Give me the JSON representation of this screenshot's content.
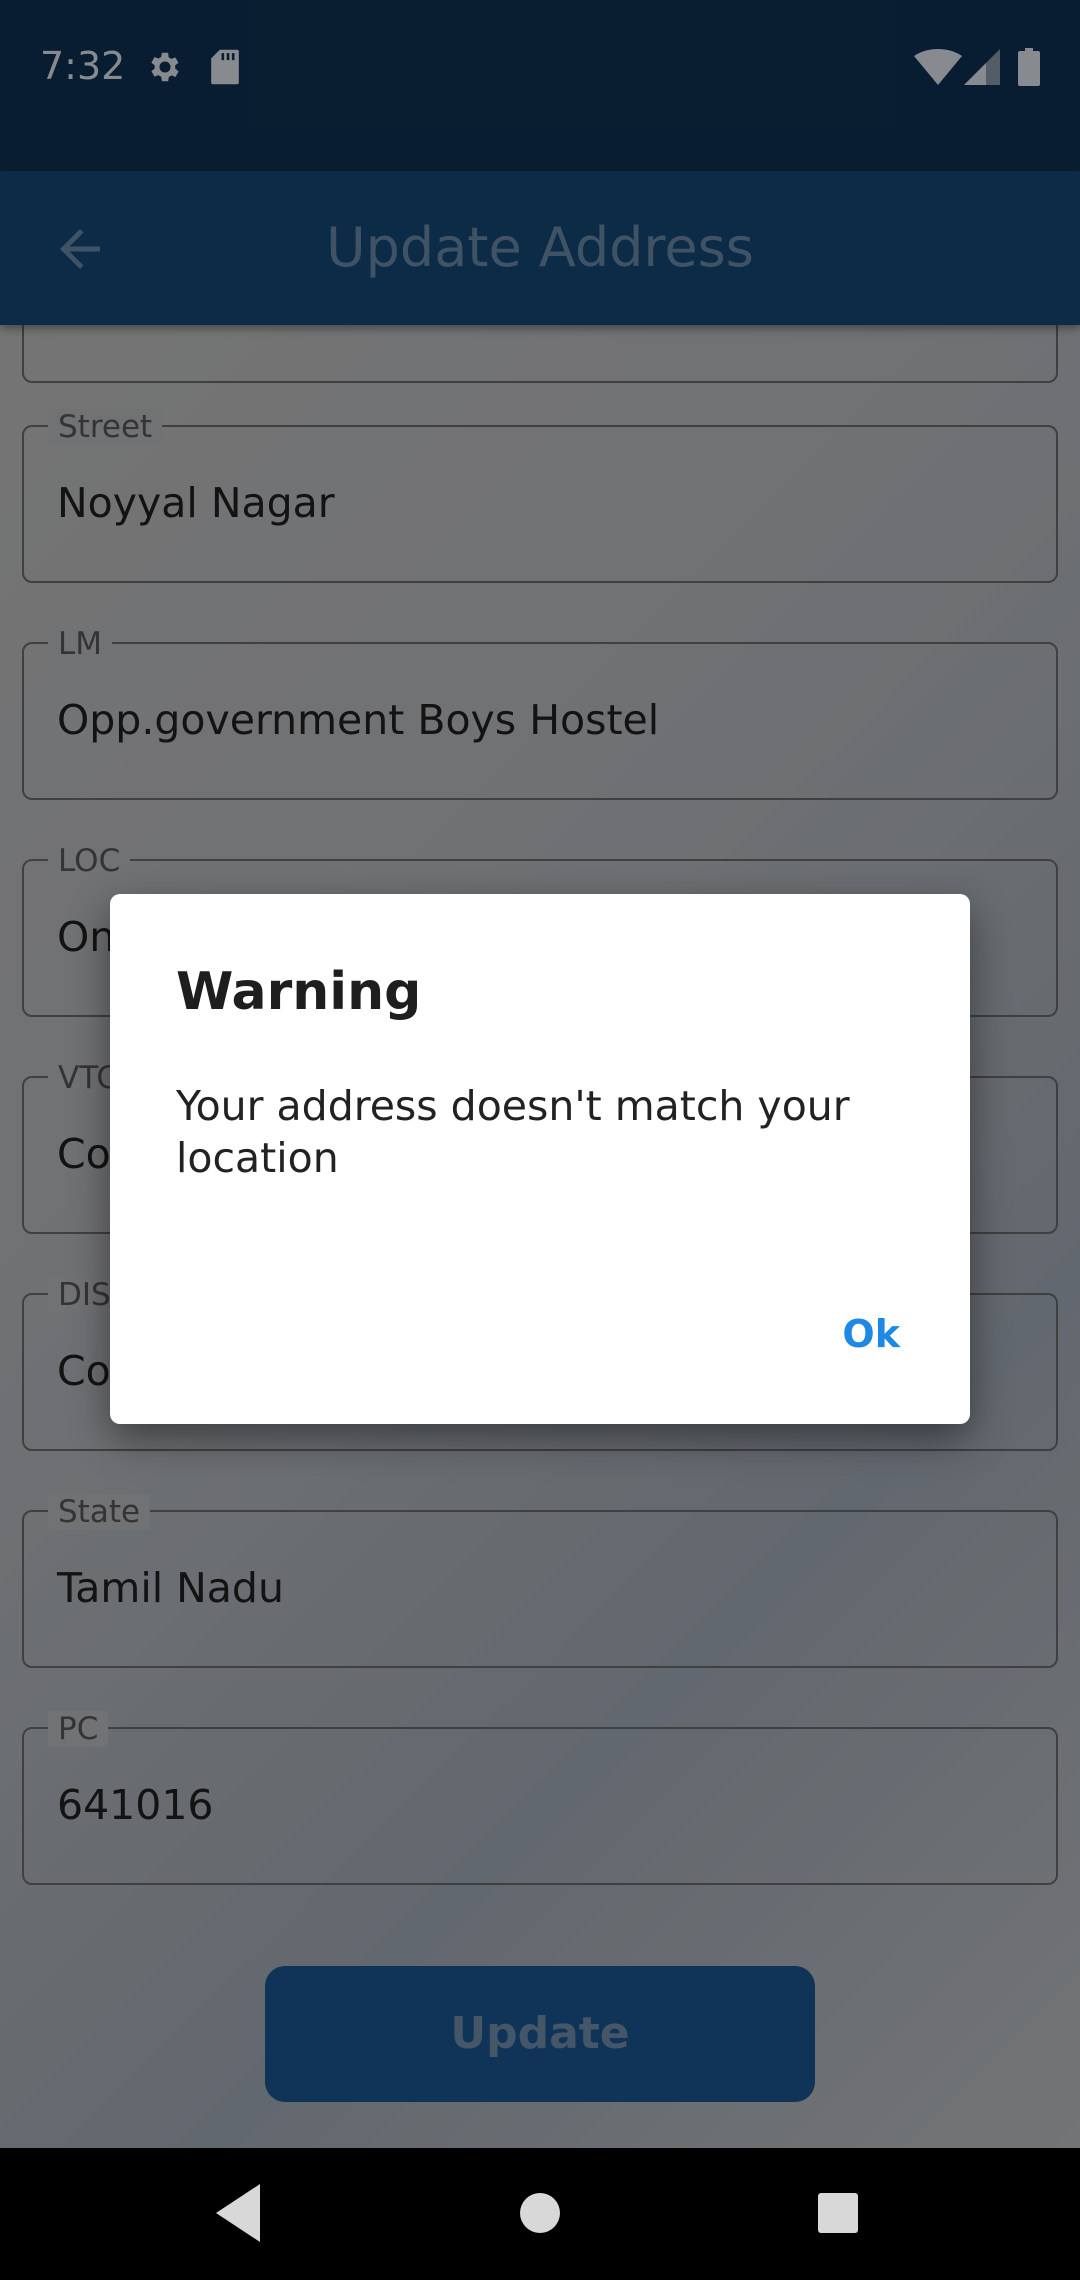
{
  "status_bar": {
    "time": "7:32",
    "left_icons": [
      "gear-icon",
      "sd-card-icon"
    ],
    "right_icons": [
      "wifi-icon",
      "signal-icon",
      "battery-icon"
    ]
  },
  "app_bar": {
    "title": "Update Address",
    "back_icon": "arrow-left-icon"
  },
  "form": {
    "fields": [
      {
        "label": "Street",
        "value": "Noyyal Nagar"
      },
      {
        "label": "LM",
        "value": "Opp.government Boys Hostel"
      },
      {
        "label": "LOC",
        "value": "On"
      },
      {
        "label": "VTC",
        "value": "Co"
      },
      {
        "label": "DIST",
        "value": "Co"
      },
      {
        "label": "State",
        "value": "Tamil Nadu"
      },
      {
        "label": "PC",
        "value": "641016"
      }
    ],
    "update_label": "Update"
  },
  "dialog": {
    "title": "Warning",
    "message": "Your address doesn't match your location",
    "ok_label": "Ok"
  },
  "nav_bar": {
    "icons": [
      "back-triangle-icon",
      "home-circle-icon",
      "recents-square-icon"
    ]
  },
  "colors": {
    "status_bar": "#0e3355",
    "app_bar": "#154a7a",
    "accent": "#1e88e5",
    "button": "#1a5a96"
  }
}
